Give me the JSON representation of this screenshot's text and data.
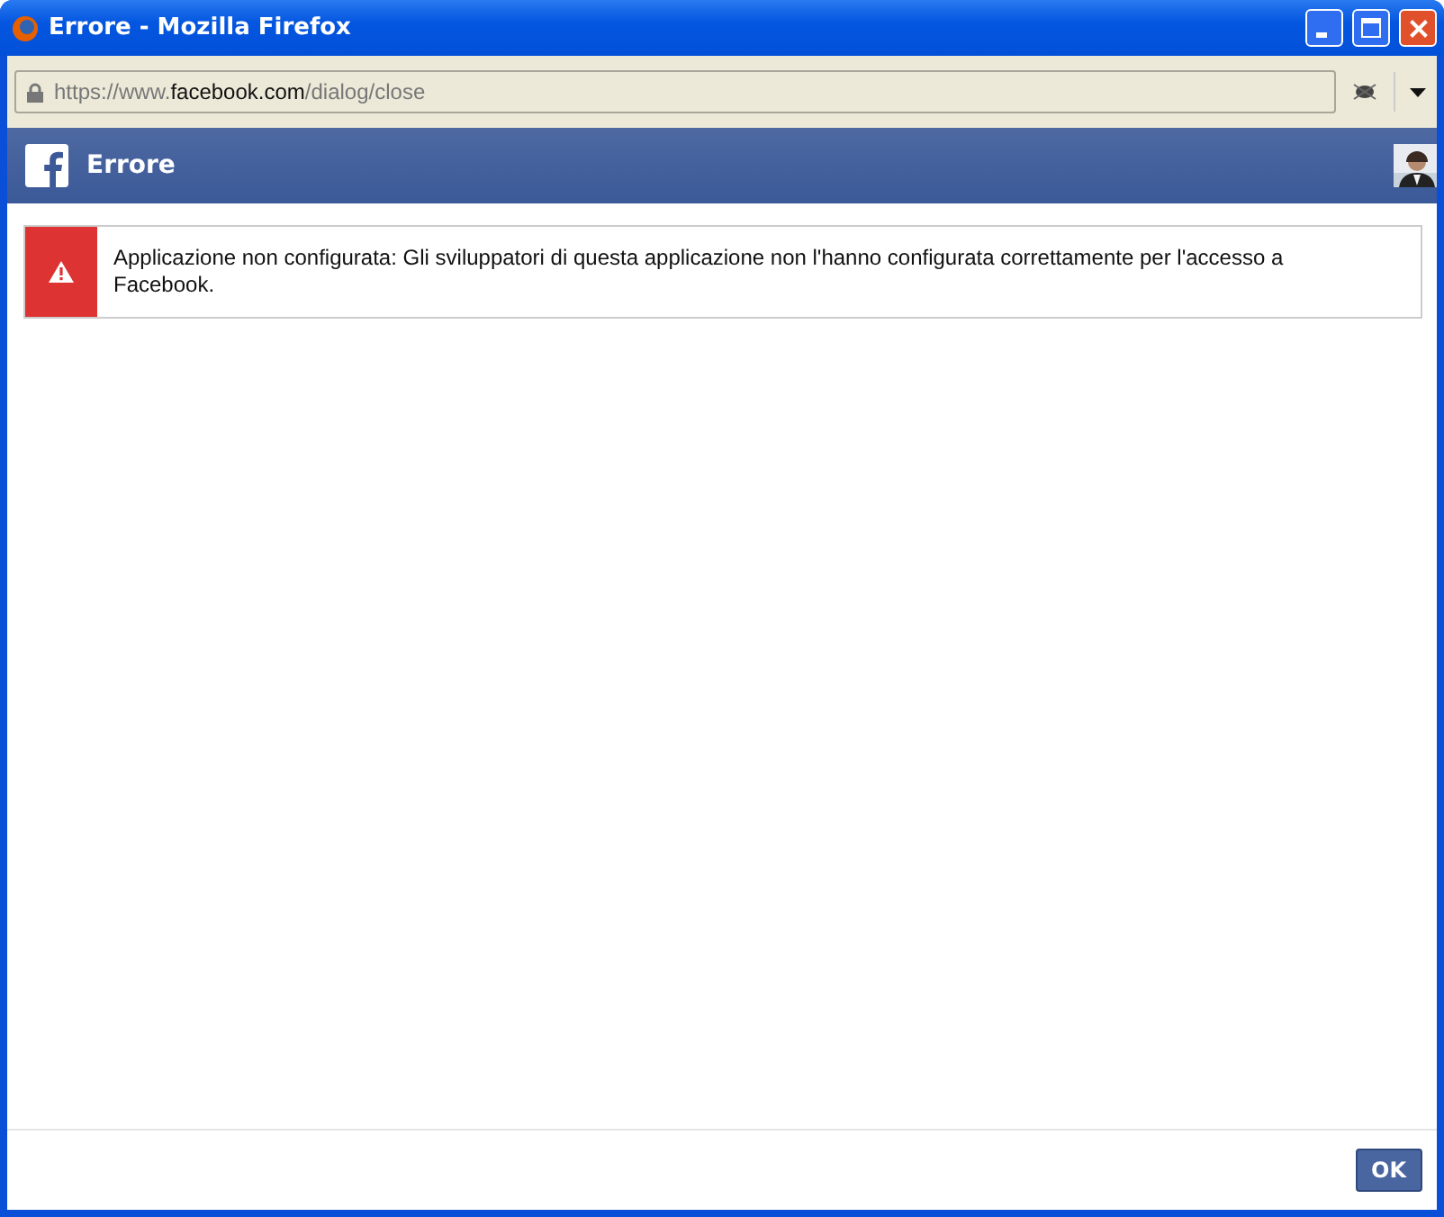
{
  "window": {
    "title": "Errore - Mozilla Firefox"
  },
  "address_bar": {
    "scheme": "https://www.",
    "domain": "facebook.com",
    "path": "/dialog/close"
  },
  "dialog": {
    "title": "Errore"
  },
  "error": {
    "message": "Applicazione non configurata: Gli sviluppatori di questa applicazione non l'hanno configurata correttamente per l'accesso a Facebook."
  },
  "buttons": [
    "OK"
  ]
}
